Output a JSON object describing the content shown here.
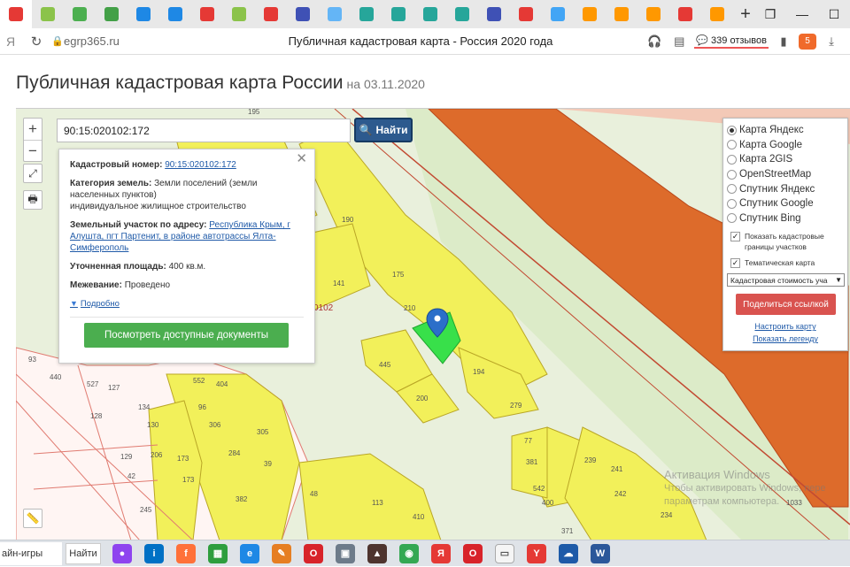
{
  "browser": {
    "tab_icon_colors": [
      "#e53935",
      "#8bc34a",
      "#4caf50",
      "#43a047",
      "#1e88e5",
      "#1e88e5",
      "#e53935",
      "#8bc34a",
      "#e53935",
      "#3f51b5",
      "#64b5f6",
      "#26a69a",
      "#26a69a",
      "#26a69a",
      "#26a69a",
      "#3f51b5",
      "#e53935",
      "#42a5f5",
      "#ff9800",
      "#ff9800",
      "#ff9800",
      "#e53935",
      "#ff9800"
    ],
    "new_tab_label": "+",
    "domain": "egrp365.ru",
    "page_title": "Публичная кадастровая карта - Россия 2020 года",
    "reviews": "339 отзывов",
    "extension_badge": "5"
  },
  "page": {
    "heading": "Публичная кадастровая карта России",
    "date": "на 03.11.2020"
  },
  "search": {
    "value": "90:15:020102:172",
    "button_label": "Найти"
  },
  "zoom": {
    "in": "+",
    "out": "−"
  },
  "popup": {
    "cadastral_label": "Кадастровый номер:",
    "cadastral_value": "90:15:020102:172",
    "category_label": "Категория земель:",
    "category_value": "Земли поселений (земли населенных пунктов)",
    "use_value": "индивидуальное жилищное строительство",
    "address_label": "Земельный участок по адресу:",
    "address_value": "Республика Крым, г Алушта, пгт Партенит, в районе автотрассы Ялта-Симферополь",
    "area_label": "Уточненная площадь:",
    "area_value": "400 кв.м.",
    "survey_label": "Межевание:",
    "survey_value": "Проведено",
    "more_link": "Подробно",
    "docs_button": "Посмотреть доступные документы"
  },
  "layers": {
    "basemaps": [
      {
        "label": "Карта Яндекс",
        "selected": true
      },
      {
        "label": "Карта Google",
        "selected": false
      },
      {
        "label": "Карта 2GIS",
        "selected": false
      },
      {
        "label": "OpenStreetMap",
        "selected": false
      },
      {
        "label": "Спутник Яндекс",
        "selected": false
      },
      {
        "label": "Спутник Google",
        "selected": false
      },
      {
        "label": "Спутник Bing",
        "selected": false
      }
    ],
    "show_borders": "Показать кадастровые границы участков",
    "thematic_map": "Тематическая карта",
    "thematic_select": "Кадастровая стоимость уча",
    "share_button": "Поделиться ссылкой",
    "configure_link": "Настроить карту",
    "legend_link": "Показать легенду"
  },
  "map_labels": {
    "parcel_numbers": [
      "195",
      "190",
      "175",
      "141",
      "210",
      "194",
      "279",
      "445",
      "200",
      "93",
      "440",
      "527",
      "127",
      "134",
      "128",
      "552",
      "404",
      "96",
      "306",
      "305",
      "130",
      "129",
      "206",
      "173",
      "284",
      "39",
      "42",
      "173",
      "382",
      "245",
      "48",
      "113",
      "410",
      "542",
      "77",
      "381",
      "400",
      "239",
      "241",
      "242",
      "234",
      "371",
      "1033"
    ],
    "quarter_fragment": "0102"
  },
  "watermark": {
    "title": "Активация Windows",
    "line1": "Чтобы активировать Windows, пере",
    "line2": "параметрам компьютера."
  },
  "taskbar": {
    "search_text": "айн-игры",
    "search_button": "Найти",
    "apps": [
      {
        "name": "alice",
        "color": "#8e44ef",
        "glyph": "●"
      },
      {
        "name": "intel",
        "color": "#0071c5",
        "glyph": "i"
      },
      {
        "name": "firefox",
        "color": "#ff7139",
        "glyph": "f"
      },
      {
        "name": "store",
        "color": "#2e9e3e",
        "glyph": "▦"
      },
      {
        "name": "ie",
        "color": "#1e88e5",
        "glyph": "e"
      },
      {
        "name": "paint",
        "color": "#e67e22",
        "glyph": "✎"
      },
      {
        "name": "opera",
        "color": "#d8232a",
        "glyph": "O"
      },
      {
        "name": "photos",
        "color": "#6d7b8a",
        "glyph": "▣"
      },
      {
        "name": "game",
        "color": "#4e342e",
        "glyph": "▲"
      },
      {
        "name": "chrome",
        "color": "#34a853",
        "glyph": "◉"
      },
      {
        "name": "yandex",
        "color": "#e53935",
        "glyph": "Я"
      },
      {
        "name": "opera2",
        "color": "#d8232a",
        "glyph": "O"
      },
      {
        "name": "files",
        "color": "#f5f5f5",
        "glyph": "▭"
      },
      {
        "name": "yandex-browser",
        "color": "#e53935",
        "glyph": "Y"
      },
      {
        "name": "cloud",
        "color": "#1e5aa8",
        "glyph": "☁"
      },
      {
        "name": "word",
        "color": "#2b579a",
        "glyph": "W"
      }
    ]
  },
  "colors": {
    "parcel_fill": "#f2f05a",
    "selected_parcel": "#38e04a",
    "road_fill": "#dd6b2b",
    "map_bg": "#e9f0dc",
    "find_button": "#2d5a8e",
    "docs_button": "#4bae4f",
    "share_button": "#d9534f"
  }
}
